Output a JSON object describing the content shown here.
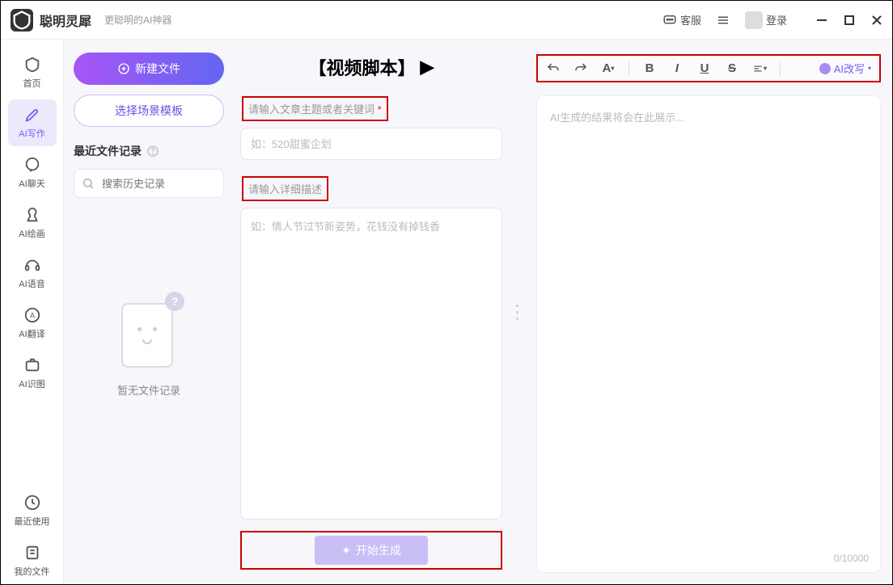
{
  "app": {
    "name": "聪明灵犀",
    "tagline": "更聪明的AI神器"
  },
  "header": {
    "support": "客服",
    "login": "登录"
  },
  "sidebar": {
    "items": [
      {
        "label": "首页"
      },
      {
        "label": "AI写作"
      },
      {
        "label": "AI聊天"
      },
      {
        "label": "AI绘画"
      },
      {
        "label": "AI语音"
      },
      {
        "label": "AI翻译"
      },
      {
        "label": "AI识图"
      }
    ],
    "bottom": [
      {
        "label": "最近使用"
      },
      {
        "label": "我的文件"
      }
    ]
  },
  "left": {
    "new_file": "新建文件",
    "choose_template": "选择场景模板",
    "recent_title": "最近文件记录",
    "search_placeholder": "搜索历史记录",
    "empty_text": "暂无文件记录"
  },
  "mid": {
    "title": "【视频脚本】",
    "label1": "请输入文章主题或者关键词",
    "placeholder1": "如：520甜蜜企划",
    "label2": "请输入详细描述",
    "placeholder2": "如：情人节过节新姿势，花钱没有掉钱香",
    "generate": "开始生成"
  },
  "right": {
    "ai_rewrite": "AI改写",
    "output_placeholder": "AI生成的结果将会在此展示...",
    "char_count": "0/10000"
  }
}
